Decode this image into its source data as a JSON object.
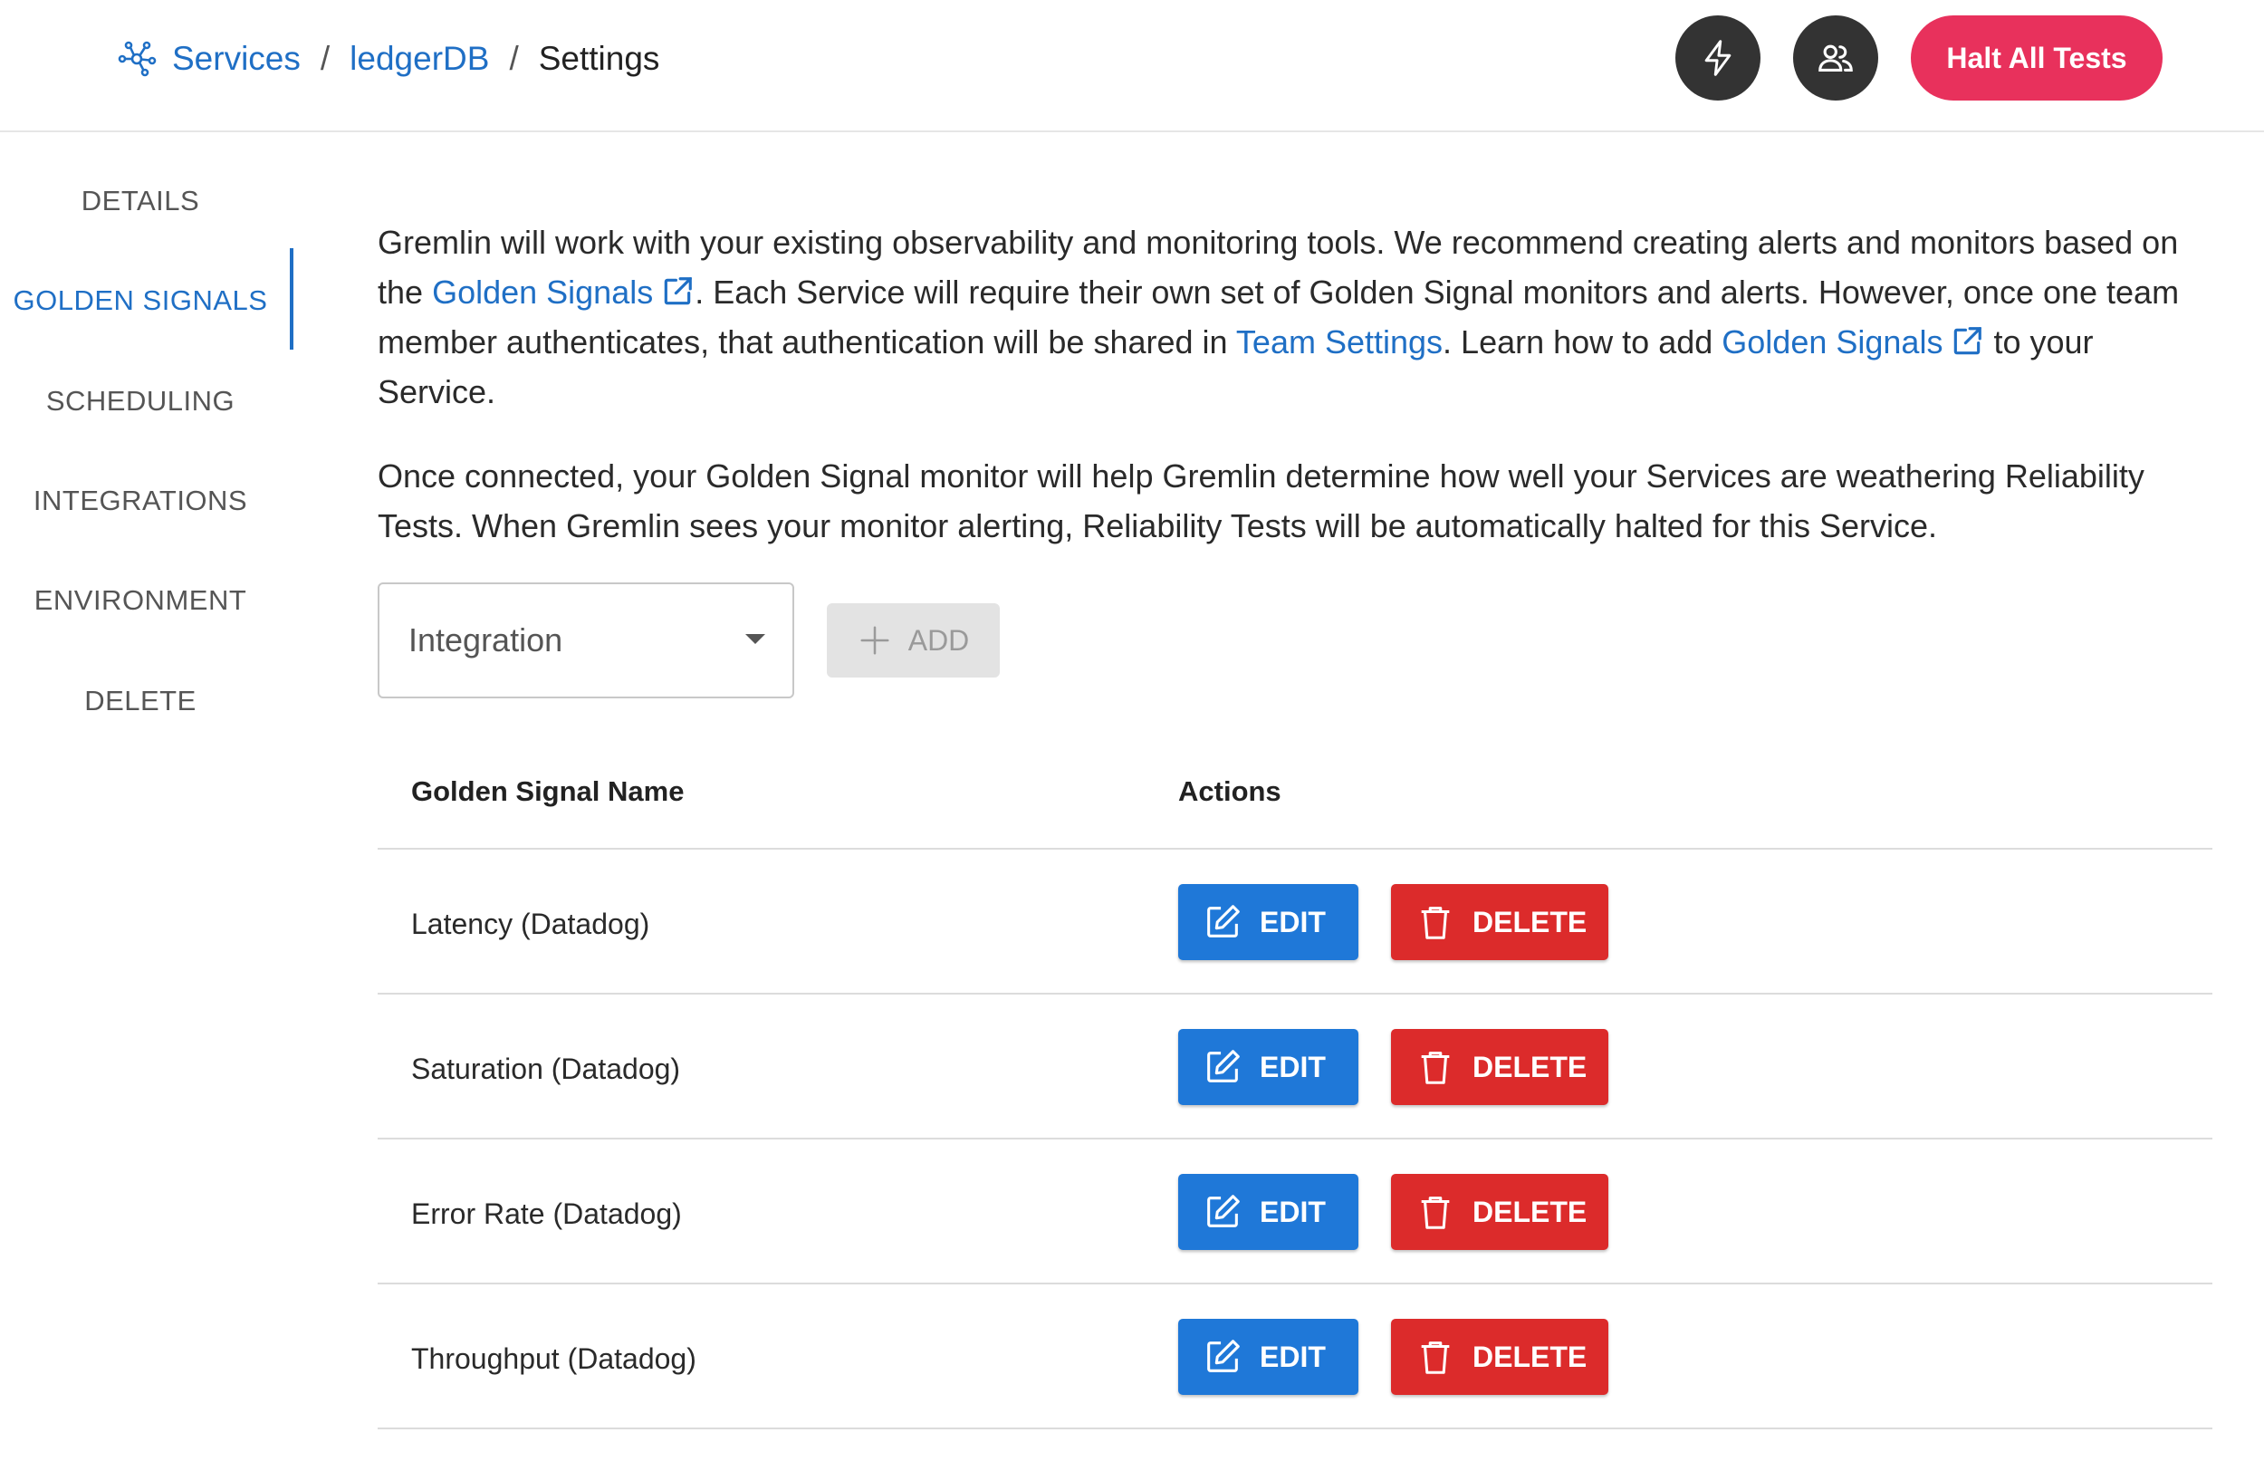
{
  "header": {
    "breadcrumb": {
      "services": "Services",
      "service_name": "ledgerDB",
      "current": "Settings",
      "separator": "/"
    },
    "halt_label": "Halt All Tests",
    "icons": {
      "breadcrumb": "services-graph-icon",
      "bolt": "lightning-bolt-icon",
      "team": "team-icon"
    },
    "halt_color": "#e8315c"
  },
  "sidebar": {
    "items": [
      {
        "label": "DETAILS"
      },
      {
        "label": "GOLDEN SIGNALS",
        "active": true
      },
      {
        "label": "SCHEDULING"
      },
      {
        "label": "INTEGRATIONS"
      },
      {
        "label": "ENVIRONMENT"
      },
      {
        "label": "DELETE"
      }
    ]
  },
  "intro": {
    "p1_a": "Gremlin will work with your existing observability and monitoring tools. We recommend creating alerts and monitors based on the",
    "p1_link1": "Golden Signals",
    "p1_b": ". Each Service will require their own set of Golden Signal monitors and alerts. However, once one team member authenticates, that authentication will be shared in",
    "p1_link2": "Team Settings",
    "p1_c": ". Learn how to add",
    "p1_link3": "Golden Signals",
    "p1_d": "to your Service.",
    "p2": "Once connected, your Golden Signal monitor will help Gremlin determine how well your Services are weathering Reliability Tests. When Gremlin sees your monitor alerting, Reliability Tests will be automatically halted for this Service."
  },
  "integration_select": {
    "placeholder": "Integration"
  },
  "add_button": {
    "label": "ADD"
  },
  "table": {
    "headers": {
      "name": "Golden Signal Name",
      "actions": "Actions"
    },
    "rows": [
      {
        "name": "Latency (Datadog)"
      },
      {
        "name": "Saturation (Datadog)"
      },
      {
        "name": "Error Rate (Datadog)"
      },
      {
        "name": "Throughput (Datadog)"
      }
    ],
    "edit_label": "EDIT",
    "delete_label": "DELETE"
  },
  "colors": {
    "accent": "#1f6fc5",
    "edit": "#1f78d8",
    "delete": "#dc2b2b"
  }
}
